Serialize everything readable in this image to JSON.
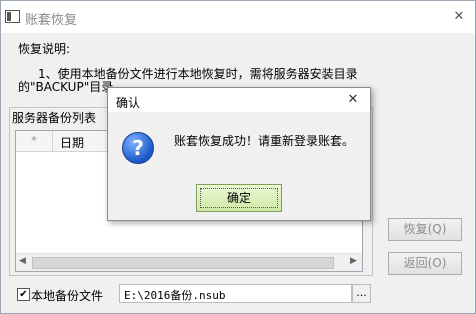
{
  "window": {
    "title": "账套恢复",
    "close_symbol": "✕"
  },
  "instructions": {
    "heading": "恢复说明:",
    "line1": "1、使用本地备份文件进行本地恢复时，需将服务器安装目录",
    "line2": "的\"BACKUP\"目录"
  },
  "backup_list": {
    "group_title": "服务器备份列表",
    "columns": [
      "*",
      "日期"
    ]
  },
  "buttons": {
    "restore": "恢复(Q)",
    "back": "返回(O)"
  },
  "local_backup": {
    "checkbox_label": "本地备份文件",
    "checked": true,
    "path": "E:\\2016备份.nsub",
    "browse_label": "..."
  },
  "dialog": {
    "title": "确认",
    "close_symbol": "✕",
    "message": "账套恢复成功！请重新登录账套。",
    "ok_label": "确定",
    "icon": "question-icon"
  }
}
